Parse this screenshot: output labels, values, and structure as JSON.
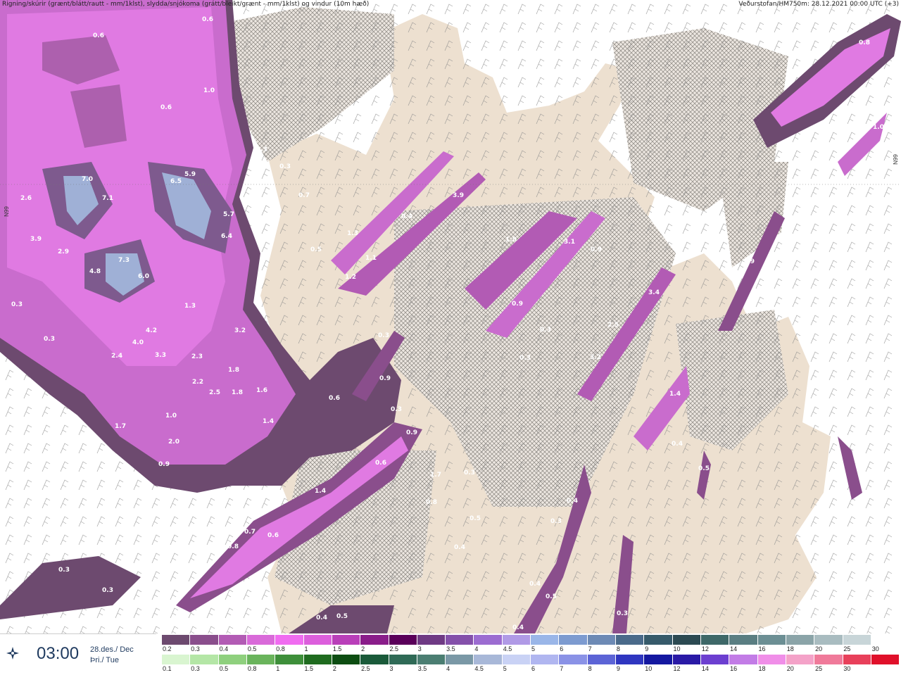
{
  "header": {
    "left": "Rigning/skúrir (grænt/blátt/rautt - mm/1klst), slydda/snjókoma (grátt/bleikt/grænt - mm/1klst) og vindur (10m hæð)",
    "right": "Veðurstofan/HM750m: 28.12.2021 00:00 UTC (+3)"
  },
  "latitude_labels": {
    "left": "N99",
    "right": "N99"
  },
  "time_panel": {
    "time": "03:00",
    "date_line1": "28.des./ Dec",
    "date_line2": "Þri./ Tue"
  },
  "legend": {
    "snow_thresholds": [
      "0.2",
      "0.3",
      "0.4",
      "0.5",
      "0.8",
      "1",
      "1.5",
      "2",
      "2.5",
      "3",
      "3.5",
      "4",
      "4.5",
      "5",
      "6",
      "7",
      "8",
      "9",
      "10",
      "12",
      "14",
      "16",
      "18",
      "20",
      "25",
      "30"
    ],
    "snow_colors": [
      "#6d4a6f",
      "#8a4e8c",
      "#b25bb4",
      "#d96ad9",
      "#f06cf0",
      "#dc5fdc",
      "#b93fb9",
      "#8a1d8a",
      "#5a005a",
      "#6f3a84",
      "#8450aa",
      "#9c6cd1",
      "#b09ae6",
      "#9ab6e8",
      "#7d9bd0",
      "#6d8ab5",
      "#4a6a8a",
      "#365a6a",
      "#2c4a52",
      "#3e6868",
      "#5a7e82",
      "#6c8f94",
      "#8ba4a8",
      "#a9bcc0",
      "#c8d5d8",
      "#ffffff"
    ],
    "rain_thresholds": [
      "0.1",
      "0.3",
      "0.5",
      "0.8",
      "1",
      "1.5",
      "2",
      "2.5",
      "3",
      "3.5",
      "4",
      "4.5",
      "5",
      "6",
      "7",
      "8",
      "9",
      "10",
      "12",
      "14",
      "16",
      "18",
      "20",
      "25",
      "30"
    ],
    "rain_colors": [
      "#d9f5d0",
      "#b4e6a6",
      "#8fd07e",
      "#6ab45c",
      "#3e8f3a",
      "#1f6b1f",
      "#0d4d12",
      "#1a5a3a",
      "#2f6a56",
      "#4b7e72",
      "#7a98a6",
      "#a8b8d8",
      "#c9d2f5",
      "#b0b6f0",
      "#8a92e6",
      "#5c64d6",
      "#2f36c0",
      "#1418a0",
      "#2a1aa6",
      "#6c3fd0",
      "#c27ce6",
      "#f08ee8",
      "#f4a2c8",
      "#f07a9a",
      "#e8405a",
      "#e0102a"
    ]
  },
  "map": {
    "value_labels": [
      "0.6",
      "0.6",
      "1.0",
      "0.6",
      "7.0",
      "2.6",
      "7.1",
      "3.9",
      "2.9",
      "5.9",
      "6.5",
      "5.7",
      "6.4",
      "7.3",
      "4.8",
      "6.0",
      "0.3",
      "1.3",
      "3.3",
      "4.2",
      "4.0",
      "2.4",
      "3.3",
      "2.3",
      "2.2",
      "3.2",
      "1.8",
      "2.5",
      "1.8",
      "1.6",
      "1.7",
      "1.0",
      "2.0",
      "0.9",
      "1.4",
      "0.3",
      "0.3",
      "0.7",
      "0.5",
      "1.3",
      "1.8",
      "3.9",
      "0.4",
      "1.1",
      "1.2",
      "0.3",
      "0.9",
      "0.6",
      "0.3",
      "0.9",
      "0.6",
      "1.4",
      "0.7",
      "0.6",
      "0.3",
      "0.3",
      "1.7",
      "0.8",
      "0.3",
      "0.5",
      "0.4",
      "0.8",
      "3.1",
      "0.9",
      "0.9",
      "0.3",
      "0.3",
      "2.5",
      "3.2",
      "3.4",
      "2.9",
      "1.4",
      "0.4",
      "0.5",
      "0.4",
      "0.3",
      "0.4",
      "0.5",
      "0.4",
      "0.3",
      "0.5",
      "0.4",
      "0.8",
      "1.0",
      "0.4"
    ]
  }
}
